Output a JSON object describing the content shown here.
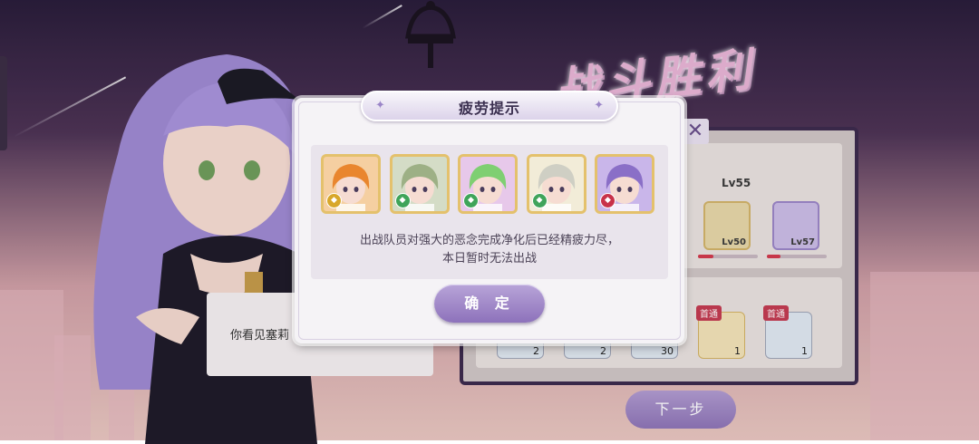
{
  "modal": {
    "title": "疲劳提示",
    "message_line1": "出战队员对强大的恶念完成净化后已经精疲力尽，",
    "message_line2": "本日暂时无法出战",
    "confirm_label": "确 定",
    "characters": [
      {
        "name": "orange-hair",
        "badge_color": "#d8a72a",
        "bg": "#f5cfa1",
        "hair": "#e9862e"
      },
      {
        "name": "green-hair-1",
        "badge_color": "#3fa45a",
        "bg": "#d4dcc6",
        "hair": "#9db085"
      },
      {
        "name": "green-hair-2",
        "badge_color": "#3fa45a",
        "bg": "#e7c8ea",
        "hair": "#7fcf72"
      },
      {
        "name": "silver-hair",
        "badge_color": "#3fa45a",
        "bg": "#f2ecd8",
        "hair": "#cfcfc4"
      },
      {
        "name": "purple-hair",
        "badge_color": "#c8324a",
        "bg": "#c9b6ea",
        "hair": "#8a6fc7"
      }
    ]
  },
  "background": {
    "title_art": "战斗胜利",
    "close_symbol": "✕",
    "level_header": "Lv55",
    "team": [
      {
        "level": "Lv50",
        "hp_pct": 25,
        "bg": "#e6d6a8"
      },
      {
        "level": "Lv57",
        "hp_pct": 22,
        "bg": "#cbbce6"
      }
    ],
    "rewards": [
      {
        "count": "2",
        "tag": ""
      },
      {
        "count": "2",
        "tag": ""
      },
      {
        "count": "30",
        "tag": ""
      },
      {
        "count": "1",
        "tag": "首通"
      },
      {
        "count": "1",
        "tag": "首通"
      }
    ],
    "next_label": "下一步",
    "dialog_text": "你看见塞莉"
  }
}
